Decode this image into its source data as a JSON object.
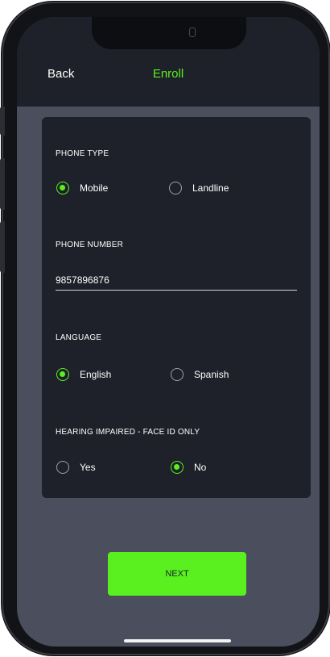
{
  "header": {
    "back_label": "Back",
    "title": "Enroll"
  },
  "form": {
    "phone_type": {
      "label": "PHONE TYPE",
      "options": [
        "Mobile",
        "Landline"
      ],
      "selected": "Mobile"
    },
    "phone_number": {
      "label": "PHONE NUMBER",
      "value": "9857896876"
    },
    "language": {
      "label": "LANGUAGE",
      "options": [
        "English",
        "Spanish"
      ],
      "selected": "English"
    },
    "hearing_impaired": {
      "label": "HEARING IMPAIRED - FACE ID ONLY",
      "options": [
        "Yes",
        "No"
      ],
      "selected": "No"
    }
  },
  "footer": {
    "next_label": "NEXT"
  },
  "colors": {
    "accent": "#5af01f",
    "background": "#4a4e5d",
    "panel": "#1e2129"
  }
}
